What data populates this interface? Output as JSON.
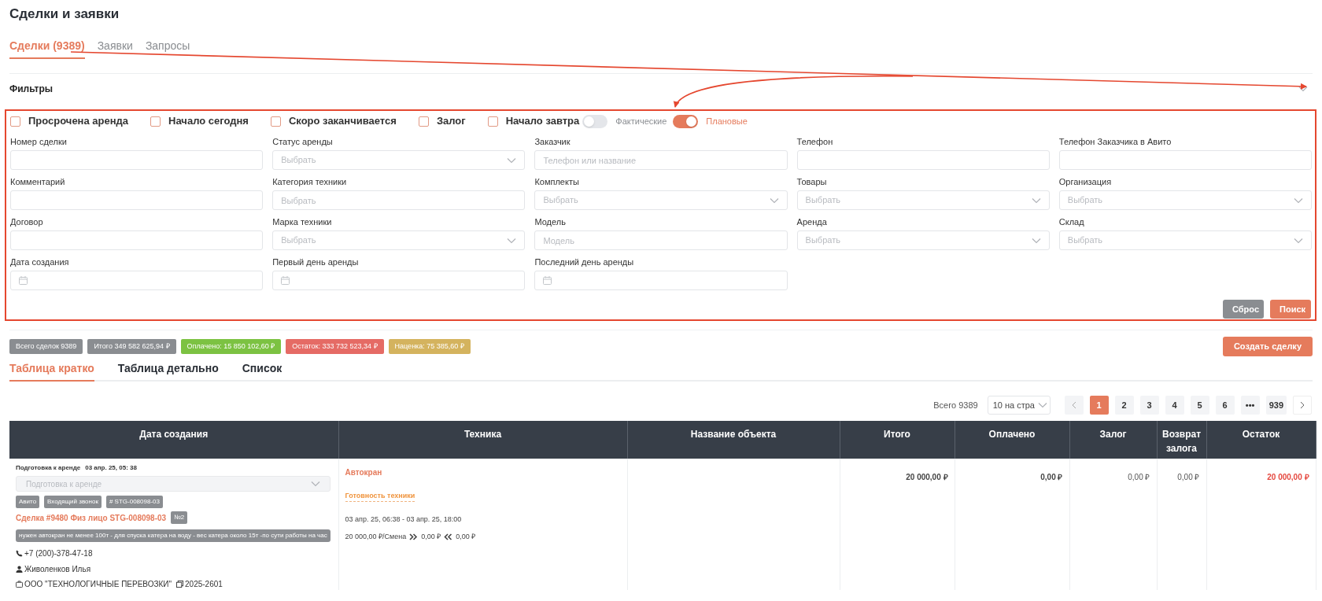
{
  "page_title": "Сделки и заявки",
  "tabs": [
    {
      "label": "Сделки (9389)",
      "selected": true
    },
    {
      "label": "Заявки",
      "selected": false
    },
    {
      "label": "Запросы",
      "selected": false
    }
  ],
  "filters": {
    "title": "Фильтры",
    "expanded": true,
    "checkboxes": [
      {
        "label": "Просрочена аренда",
        "checked": false
      },
      {
        "label": "Начало сегодня",
        "checked": false
      },
      {
        "label": "Скоро заканчивается",
        "checked": false
      },
      {
        "label": "Залог",
        "checked": false
      },
      {
        "label": "Начало завтра",
        "checked": false
      }
    ],
    "toggles": [
      {
        "label": "Фактические",
        "on": false
      },
      {
        "label": "Плановые",
        "on": true
      }
    ],
    "fields": [
      {
        "label": "Номер сделки",
        "kind": "text"
      },
      {
        "label": "Статус аренды",
        "kind": "select",
        "placeholder": "Выбрать"
      },
      {
        "label": "Заказчик",
        "kind": "text",
        "placeholder": "Телефон или название"
      },
      {
        "label": "Телефон",
        "kind": "text"
      },
      {
        "label": "Телефон Заказчика в Авито",
        "kind": "text"
      },
      {
        "label": "Комментарий",
        "kind": "text"
      },
      {
        "label": "Категория техники",
        "kind": "text",
        "placeholder": "Выбрать"
      },
      {
        "label": "Комплекты",
        "kind": "select",
        "placeholder": "Выбрать"
      },
      {
        "label": "Товары",
        "kind": "select",
        "placeholder": "Выбрать"
      },
      {
        "label": "Организация",
        "kind": "select",
        "placeholder": "Выбрать"
      },
      {
        "label": "Договор",
        "kind": "text"
      },
      {
        "label": "Марка техники",
        "kind": "select",
        "placeholder": "Выбрать"
      },
      {
        "label": "Модель",
        "kind": "text",
        "placeholder": "Модель"
      },
      {
        "label": "Аренда",
        "kind": "select",
        "placeholder": "Выбрать"
      },
      {
        "label": "Склад",
        "kind": "select",
        "placeholder": "Выбрать"
      },
      {
        "label": "Дата создания",
        "kind": "date"
      },
      {
        "label": "Первый день аренды",
        "kind": "date"
      },
      {
        "label": "Последний день аренды",
        "kind": "date"
      }
    ],
    "buttons": [
      {
        "label": "Сброс",
        "kind": "secondary"
      },
      {
        "label": "Поиск",
        "kind": "primary"
      }
    ]
  },
  "stats": [
    {
      "text": "Всего сделок 9389",
      "color": "#8a8d91"
    },
    {
      "text": "Итого 349 582 625,94 ₽",
      "color": "#8a8d91"
    },
    {
      "text": "Оплачено: 15 850 102,60 ₽",
      "color": "#7cc242"
    },
    {
      "text": "Остаток: 333 732 523,34 ₽",
      "color": "#e56b65"
    },
    {
      "text": "Наценка: 75 385,60 ₽",
      "color": "#d4b35e"
    }
  ],
  "create_button": "Создать сделку",
  "view_tabs": [
    {
      "label": "Таблица кратко",
      "selected": true
    },
    {
      "label": "Таблица детально",
      "selected": false
    },
    {
      "label": "Список",
      "selected": false
    }
  ],
  "pagination": {
    "total": "Всего 9389",
    "page_size": "10 на стра",
    "pages": [
      {
        "label": "1",
        "selected": true
      },
      {
        "label": "2",
        "selected": false
      },
      {
        "label": "3",
        "selected": false
      },
      {
        "label": "4",
        "selected": false
      },
      {
        "label": "5",
        "selected": false
      },
      {
        "label": "6",
        "selected": false
      },
      {
        "label": "•••",
        "selected": false
      },
      {
        "label": "939",
        "selected": false
      }
    ]
  },
  "table": {
    "columns": [
      "Дата создания",
      "Техника",
      "Название объекта",
      "Итого",
      "Оплачено",
      "Залог",
      "Возврат залога",
      "Остаток"
    ],
    "rows": [
      {
        "status_label": "Подготовка к аренде",
        "created": "03 апр. 25, 05: 38",
        "status_select": "Подготовка к аренде",
        "tags": [
          "Авито",
          "Входящий звонок",
          "# STG-008098-03"
        ],
        "deal": "Сделка #9480 Физ лицо STG-008098-03",
        "deal_number": "№2",
        "comment": "нужен автокран не менее 100т - для спуска катера на воду - вес катера около 15т -по сути работы на час",
        "phone": "+7 (200)-378-47-18",
        "person": "Живоленков Илья",
        "organization": "ООО \"ТЕХНОЛОГИЧНЫЕ ПЕРЕВОЗКИ\"",
        "org_code": "2025-2601",
        "equipment": "Автокран",
        "readiness": "Готовность техники",
        "period": "03 апр. 25, 06:38 - 03 апр. 25, 18:00",
        "price": "20 000,00 ₽/Смена",
        "forward": "0,00 ₽",
        "back": "0,00 ₽",
        "total": "20 000,00 ₽",
        "paid": "0,00 ₽",
        "deposit": "0,00 ₽",
        "deposit_return": "0,00 ₽",
        "remainder": "20 000,00 ₽"
      }
    ]
  }
}
